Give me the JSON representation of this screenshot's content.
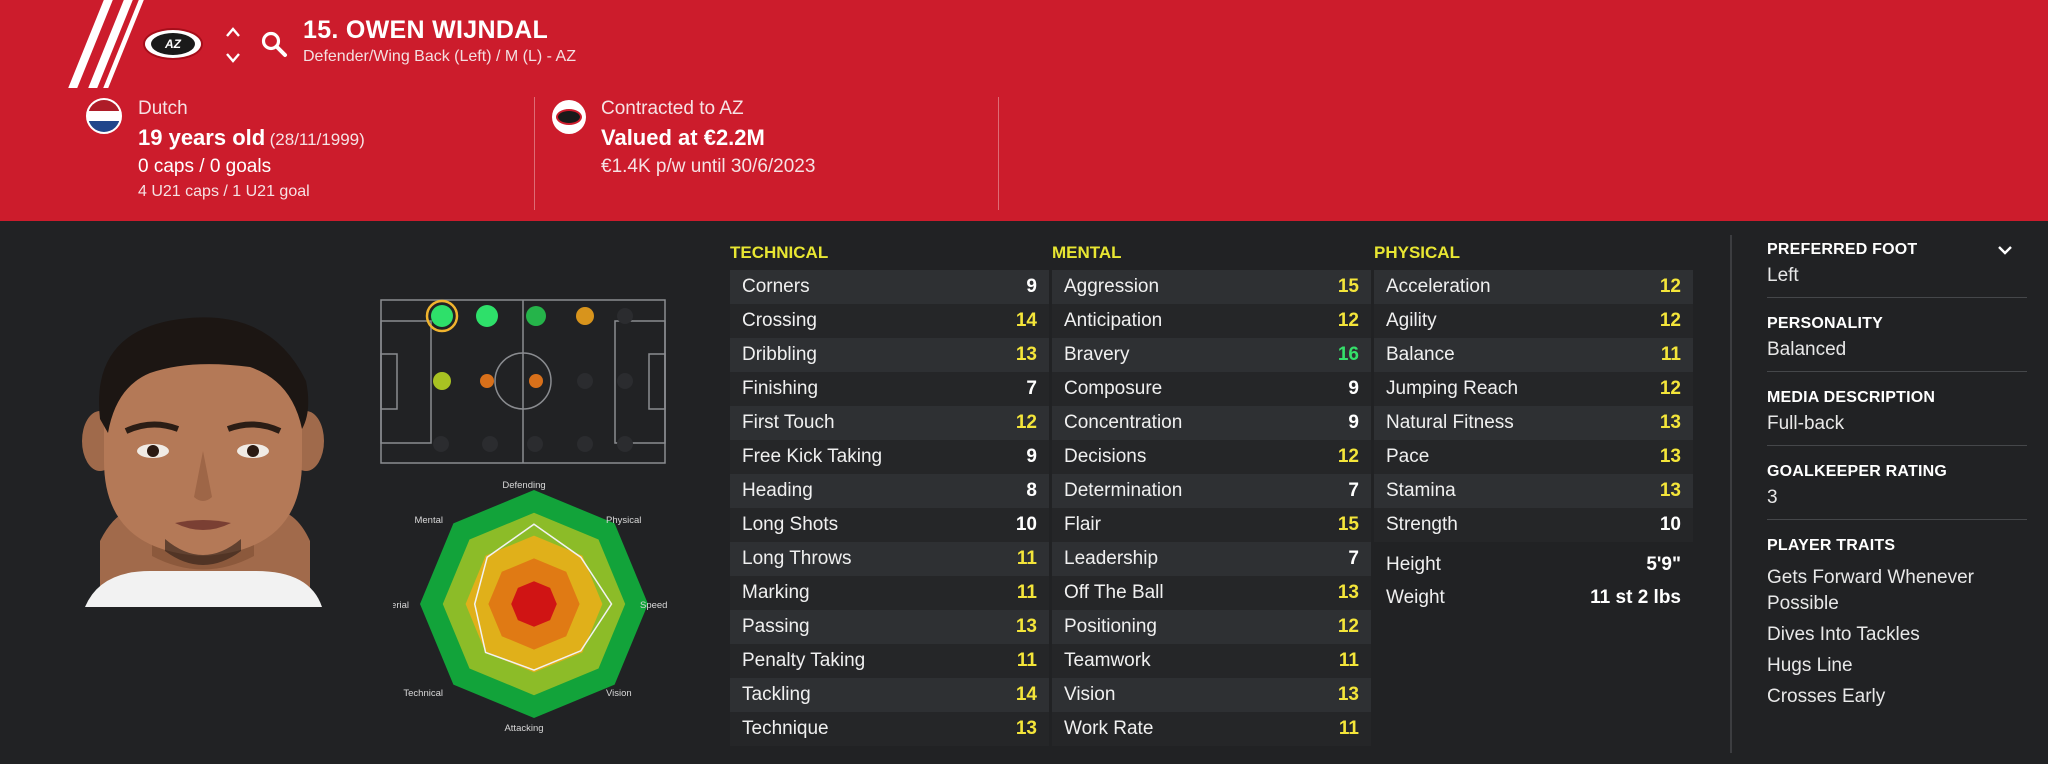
{
  "header": {
    "player_name": "15. OWEN WIJNDAL",
    "positions": "Defender/Wing Back (Left) / M (L) - AZ",
    "club_badge_text": "AZ",
    "nationality": "Dutch",
    "age": "19 years old",
    "dob": "(28/11/1999)",
    "caps": "0 caps / 0 goals",
    "u21_caps": "4 U21 caps / 1 U21 goal",
    "contract_club": "Contracted to AZ",
    "value": "Valued at €2.2M",
    "wage": "€1.4K p/w until 30/6/2023",
    "brand_color": "#cc1c2c"
  },
  "radar": {
    "labels": [
      "Defending",
      "Physical",
      "Speed",
      "Vision",
      "Attacking",
      "Technical",
      "Aerial",
      "Mental"
    ],
    "values": [
      0.7,
      0.58,
      0.68,
      0.58,
      0.58,
      0.6,
      0.52,
      0.58
    ]
  },
  "columns": {
    "technical": {
      "title": "TECHNICAL",
      "rows": [
        {
          "name": "Corners",
          "value": 9
        },
        {
          "name": "Crossing",
          "value": 14
        },
        {
          "name": "Dribbling",
          "value": 13
        },
        {
          "name": "Finishing",
          "value": 7
        },
        {
          "name": "First Touch",
          "value": 12
        },
        {
          "name": "Free Kick Taking",
          "value": 9
        },
        {
          "name": "Heading",
          "value": 8
        },
        {
          "name": "Long Shots",
          "value": 10
        },
        {
          "name": "Long Throws",
          "value": 11
        },
        {
          "name": "Marking",
          "value": 11
        },
        {
          "name": "Passing",
          "value": 13
        },
        {
          "name": "Penalty Taking",
          "value": 11
        },
        {
          "name": "Tackling",
          "value": 14
        },
        {
          "name": "Technique",
          "value": 13
        }
      ]
    },
    "mental": {
      "title": "MENTAL",
      "rows": [
        {
          "name": "Aggression",
          "value": 15
        },
        {
          "name": "Anticipation",
          "value": 12
        },
        {
          "name": "Bravery",
          "value": 16
        },
        {
          "name": "Composure",
          "value": 9
        },
        {
          "name": "Concentration",
          "value": 9
        },
        {
          "name": "Decisions",
          "value": 12
        },
        {
          "name": "Determination",
          "value": 7
        },
        {
          "name": "Flair",
          "value": 15
        },
        {
          "name": "Leadership",
          "value": 7
        },
        {
          "name": "Off The Ball",
          "value": 13
        },
        {
          "name": "Positioning",
          "value": 12
        },
        {
          "name": "Teamwork",
          "value": 11
        },
        {
          "name": "Vision",
          "value": 13
        },
        {
          "name": "Work Rate",
          "value": 11
        }
      ]
    },
    "physical": {
      "title": "PHYSICAL",
      "rows": [
        {
          "name": "Acceleration",
          "value": 12
        },
        {
          "name": "Agility",
          "value": 12
        },
        {
          "name": "Balance",
          "value": 11
        },
        {
          "name": "Jumping Reach",
          "value": 12
        },
        {
          "name": "Natural Fitness",
          "value": 13
        },
        {
          "name": "Pace",
          "value": 13
        },
        {
          "name": "Stamina",
          "value": 13
        },
        {
          "name": "Strength",
          "value": 10
        }
      ],
      "height_label": "Height",
      "height": "5'9\"",
      "weight_label": "Weight",
      "weight": "11 st 2 lbs"
    }
  },
  "value_colors": {
    "white": "#ffffff",
    "yellow": "#f4e53a",
    "green": "#35e06a"
  },
  "right_panel": {
    "preferred_foot_label": "PREFERRED FOOT",
    "preferred_foot": "Left",
    "personality_label": "PERSONALITY",
    "personality": "Balanced",
    "media_label": "MEDIA DESCRIPTION",
    "media": "Full-back",
    "gk_label": "GOALKEEPER RATING",
    "gk": "3",
    "traits_label": "PLAYER TRAITS",
    "traits": [
      "Gets Forward Whenever Possible",
      "Dives Into Tackles",
      "Hugs Line",
      "Crosses Early"
    ]
  }
}
